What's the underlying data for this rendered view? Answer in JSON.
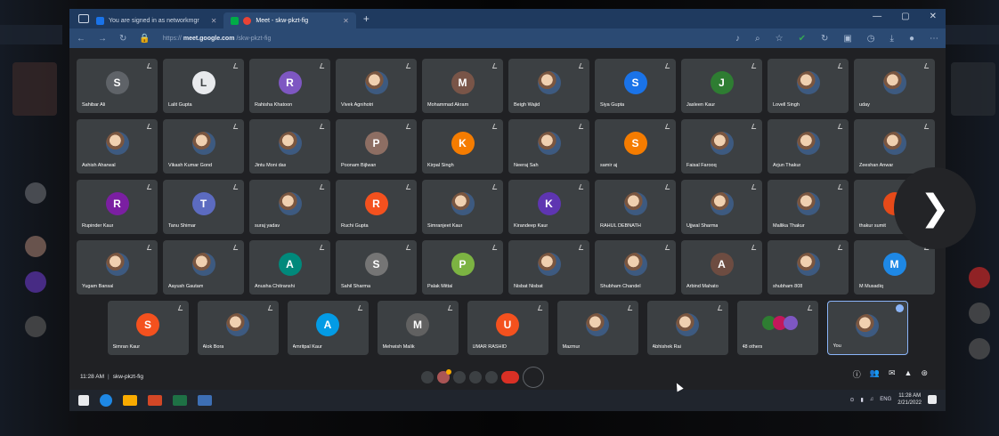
{
  "browser": {
    "tabs": [
      {
        "label": "You are signed in as networkmgr",
        "active": false,
        "favicon_color": "#1a73e8"
      },
      {
        "label": "Meet - skw-pkzt-fig",
        "active": true,
        "favicon_color": "#00ac47"
      }
    ],
    "url_prefix": "https://",
    "url_host": "meet.google.com",
    "url_path": "/skw-pkzt-fig"
  },
  "participants_rows": [
    [
      {
        "name": "Sahibar Ali",
        "initial": "S",
        "color": "#5f6368"
      },
      {
        "name": "Lalit Gupta",
        "initial": "L",
        "color": "#e8eaed"
      },
      {
        "name": "Rahisha Khatoon",
        "initial": "R",
        "color": "#7e57c2"
      },
      {
        "name": "Vivek Agnihotri",
        "initial": "",
        "color": "photo"
      },
      {
        "name": "Mohammad Akram",
        "initial": "M",
        "color": "#795548"
      },
      {
        "name": "Beigh Wajid",
        "initial": "",
        "color": "photo"
      },
      {
        "name": "Siya Gupta",
        "initial": "S",
        "color": "#1a73e8"
      },
      {
        "name": "Jasleen Kaur",
        "initial": "J",
        "color": "#2e7d32"
      },
      {
        "name": "Lovell Singh",
        "initial": "",
        "color": "photo"
      },
      {
        "name": "uday",
        "initial": "",
        "color": "photo"
      }
    ],
    [
      {
        "name": "Ashish Aharwal",
        "initial": "",
        "color": "photo"
      },
      {
        "name": "Vikash Kumar Gond",
        "initial": "",
        "color": "photo"
      },
      {
        "name": "Jintu Moni das",
        "initial": "",
        "color": "photo"
      },
      {
        "name": "Poonam Bijlwan",
        "initial": "P",
        "color": "#8d6e63"
      },
      {
        "name": "Kirpal Singh",
        "initial": "K",
        "color": "#f57c00"
      },
      {
        "name": "Neeraj Sah",
        "initial": "",
        "color": "photo"
      },
      {
        "name": "samir aj",
        "initial": "S",
        "color": "#f57c00"
      },
      {
        "name": "Faisal Farooq",
        "initial": "",
        "color": "photo"
      },
      {
        "name": "Arjun Thakur",
        "initial": "",
        "color": "photo"
      },
      {
        "name": "Zeeshan Anwar",
        "initial": "",
        "color": "photo"
      }
    ],
    [
      {
        "name": "Rupinder Kaur",
        "initial": "R",
        "color": "#7b1fa2"
      },
      {
        "name": "Tanu Shimar",
        "initial": "T",
        "color": "#5c6bc0"
      },
      {
        "name": "suraj yadav",
        "initial": "",
        "color": "photo"
      },
      {
        "name": "Ruchi Gupta",
        "initial": "R",
        "color": "#f4511e"
      },
      {
        "name": "Simranjeet Kaur",
        "initial": "",
        "color": "photo"
      },
      {
        "name": "Kirandeep Kaur",
        "initial": "K",
        "color": "#5e35b1"
      },
      {
        "name": "RAHUL DEBNATH",
        "initial": "",
        "color": "photo"
      },
      {
        "name": "Ujjwal Sharma",
        "initial": "",
        "color": "photo"
      },
      {
        "name": "Mallika Thakur",
        "initial": "",
        "color": "photo"
      },
      {
        "name": "thakur sumit",
        "initial": "",
        "color": "#e64a19"
      }
    ],
    [
      {
        "name": "Yugam Bansal",
        "initial": "",
        "color": "photo"
      },
      {
        "name": "Aayush Gautam",
        "initial": "",
        "color": "photo"
      },
      {
        "name": "Anusha Chitranshi",
        "initial": "A",
        "color": "#00897b"
      },
      {
        "name": "Sahil Sharma",
        "initial": "S",
        "color": "#757575"
      },
      {
        "name": "Palak Mittal",
        "initial": "P",
        "color": "#7cb342"
      },
      {
        "name": "Nisbat Nisbat",
        "initial": "",
        "color": "photo"
      },
      {
        "name": "Shubham Chandel",
        "initial": "",
        "color": "photo"
      },
      {
        "name": "Arbind Mahato",
        "initial": "A",
        "color": "#6d4c41"
      },
      {
        "name": "shubham 808",
        "initial": "",
        "color": "photo"
      },
      {
        "name": "M Musadiq",
        "initial": "M",
        "color": "#1e88e5"
      }
    ],
    [
      {
        "name": "Simran Kaur",
        "initial": "S",
        "color": "#f4511e"
      },
      {
        "name": "Alok Bora",
        "initial": "",
        "color": "photo"
      },
      {
        "name": "Amritpal Kaur",
        "initial": "A",
        "color": "#039be5"
      },
      {
        "name": "Mehwish Malik",
        "initial": "M",
        "color": "#616161"
      },
      {
        "name": "UMAR RASHID",
        "initial": "U",
        "color": "#f4511e"
      },
      {
        "name": "Mazmur",
        "initial": "",
        "color": "photo"
      },
      {
        "name": "Abhishek Rai",
        "initial": "",
        "color": "photo"
      },
      {
        "name": "48 others",
        "initial": "",
        "color": "others"
      },
      {
        "name": "You",
        "initial": "",
        "color": "photo"
      }
    ]
  ],
  "meet": {
    "time": "11:28 AM",
    "meeting_code": "skw-pkzt-fig"
  },
  "taskbar": {
    "lang": "ENG",
    "clock_time": "11:28 AM",
    "clock_date": "2/21/2022"
  },
  "next_glyph": "❯"
}
